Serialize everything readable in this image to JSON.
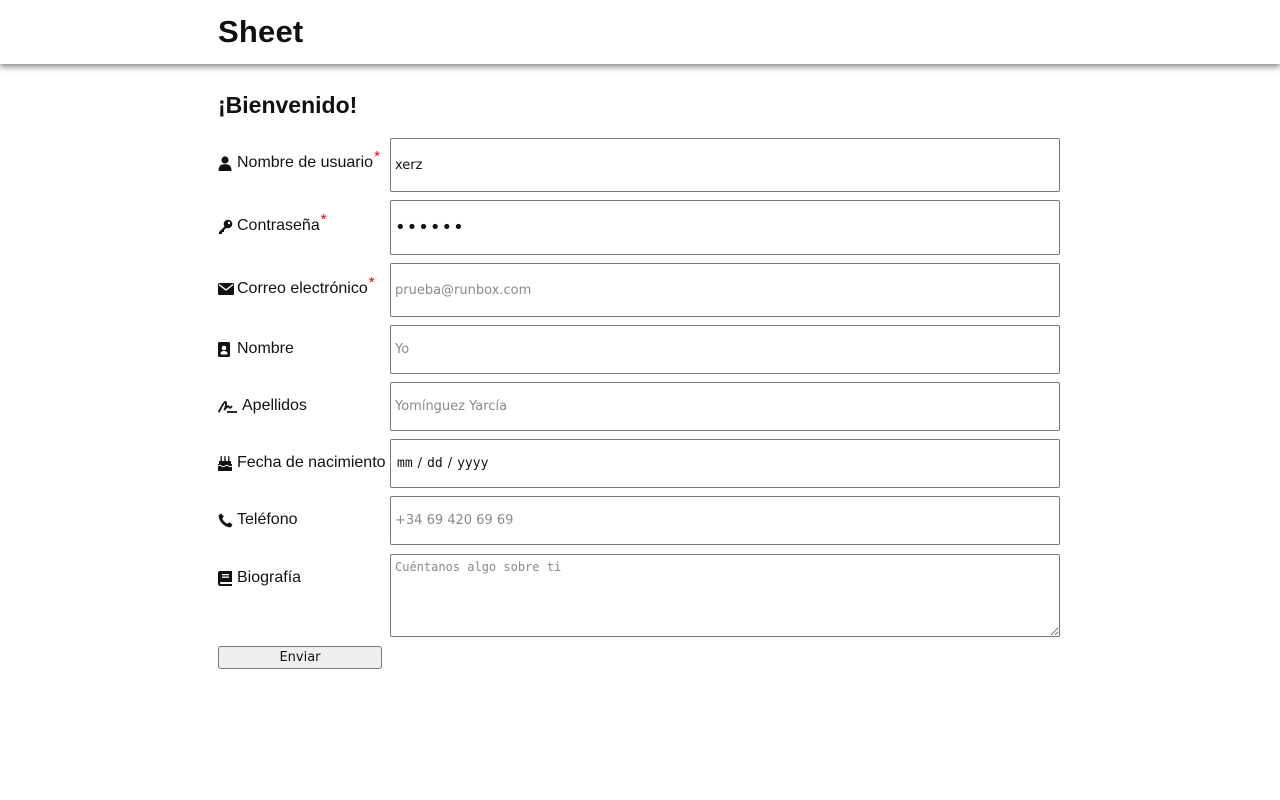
{
  "header": {
    "brand": "Sheet"
  },
  "form": {
    "heading": "¡Bienvenido!",
    "required_mark": "*",
    "username": {
      "icon": "user-icon",
      "label": "Nombre de usuario",
      "required": true,
      "value": "xerz"
    },
    "password": {
      "icon": "key-icon",
      "label": "Contraseña",
      "required": true,
      "value": "••••••"
    },
    "email": {
      "icon": "envelope-icon",
      "label": "Correo electrónico",
      "required": true,
      "placeholder": "prueba@runbox.com"
    },
    "first_name": {
      "icon": "address-card-icon",
      "label": "Nombre",
      "placeholder": "Yo"
    },
    "last_name": {
      "icon": "signature-icon",
      "label": "Apellidos",
      "placeholder": "Yomínguez Yarcía"
    },
    "birthdate": {
      "icon": "birthday-cake-icon",
      "label": "Fecha de nacimiento",
      "mm": "mm",
      "dd": "dd",
      "yyyy": "yyyy",
      "sep": "/"
    },
    "phone": {
      "icon": "phone-icon",
      "label": "Teléfono",
      "placeholder": "+34 69 420 69 69"
    },
    "bio": {
      "icon": "book-icon",
      "label": "Biografía",
      "placeholder": "Cuéntanos algo sobre ti"
    },
    "submit_label": "Enviar"
  }
}
